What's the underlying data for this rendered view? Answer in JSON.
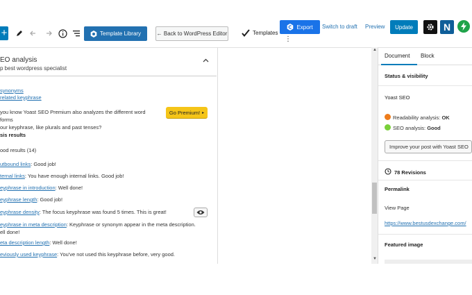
{
  "toolbar": {
    "add_icon": "+",
    "template_library_label": "Template Library",
    "back_to_wp_label": "← Back to WordPress Editor",
    "templates_label": "Templates",
    "export_label": "Export",
    "switch_to_draft_label": "Switch to draft",
    "preview_label": "Preview",
    "update_label": "Update",
    "n_label": "N",
    "more_dots": "⋮",
    "colors": {
      "primary": "#007cba",
      "export_blue": "#1a73e8",
      "premium_yellow": "#f5c518",
      "bolt_green": "#1fa34a"
    }
  },
  "seo_panel": {
    "title": "EO analysis",
    "subtitle": "p best wordpress specialist",
    "links": {
      "synonyms": "synonyms",
      "related_keyphrase": "related keyphrase"
    },
    "premium_text_line1": "you know Yoast SEO Premium also analyzes the different word forms",
    "premium_text_line2": "our keyphrase, like plurals and past tenses?",
    "go_premium_label": "Go Premium!",
    "go_premium_arrow": "▸",
    "analysis_heading": "sis results",
    "good_results_label": "ood results (14)",
    "results": [
      {
        "link": "utbound links",
        "text": ": Good job!"
      },
      {
        "link": "ternal links",
        "text": ": You have enough internal links. Good job!"
      },
      {
        "link": "eyphrase in introduction",
        "text": ": Well done!"
      },
      {
        "link": "eyphrase length",
        "text": ": Good job!"
      },
      {
        "link": "eyphrase density",
        "text": ": The focus keyphrase was found 5 times. This is great!"
      },
      {
        "link": "eyphrase in meta description",
        "text": ": Keyphrase or synonym appear in the meta description."
      },
      {
        "link": "",
        "text": "ell done!"
      },
      {
        "link": "eta description length",
        "text": ": Well done!"
      },
      {
        "link": "eviously used keyphrase",
        "text": ": You've not used this keyphrase before, very good."
      }
    ]
  },
  "sidebar": {
    "tab_document": "Document",
    "tab_block": "Block",
    "status_visibility": "Status & visibility",
    "yoast_seo": "Yoast SEO",
    "readability_prefix": "Readability analysis: ",
    "readability_value": "OK",
    "seo_prefix": "SEO analysis: ",
    "seo_value": "Good",
    "improve_button": "Improve your post with Yoast SEO",
    "revisions": "78 Revisions",
    "permalink": "Permalink",
    "view_page": "View Page",
    "permalink_url": "https://www.bestusdexchange.com/",
    "featured_image": "Featured image",
    "status_colors": {
      "ok": "#ee7c1b",
      "good": "#7ad03a"
    }
  }
}
